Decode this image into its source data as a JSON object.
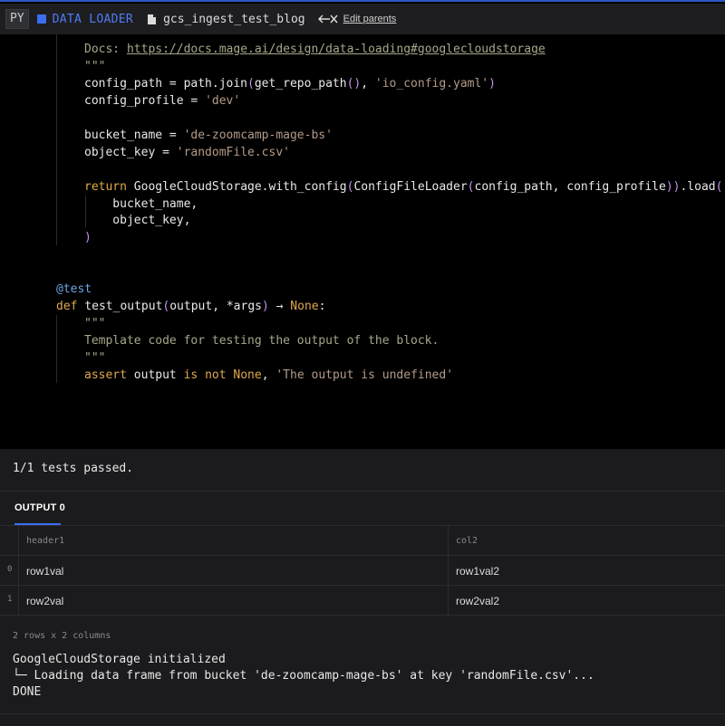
{
  "header": {
    "lang_badge": "PY",
    "block_type": "DATA LOADER",
    "block_name": "gcs_ingest_test_blog",
    "edit_parents": "Edit parents",
    "colors": {
      "accent": "#3a6ff0",
      "bar": "#1e1e21"
    }
  },
  "code": {
    "lines": [
      {
        "t": [
          [
            "c-doc",
            "Docs: "
          ],
          [
            "c-link",
            "https://docs.mage.ai/design/data-loading#googlecloudstorage"
          ]
        ]
      },
      {
        "t": [
          [
            "c-doc",
            "\"\"\""
          ]
        ]
      },
      {
        "t": [
          [
            "c-plain",
            "config_path = path.join"
          ],
          [
            "c-paren",
            "("
          ],
          [
            "c-plain",
            "get_repo_path"
          ],
          [
            "c-paren",
            "()"
          ],
          [
            "c-plain",
            ", "
          ],
          [
            "c-str",
            "'io_config.yaml'"
          ],
          [
            "c-paren",
            ")"
          ]
        ]
      },
      {
        "t": [
          [
            "c-plain",
            "config_profile = "
          ],
          [
            "c-str",
            "'dev'"
          ]
        ]
      },
      {
        "t": []
      },
      {
        "t": [
          [
            "c-plain",
            "bucket_name = "
          ],
          [
            "c-str",
            "'de-zoomcamp-mage-bs'"
          ]
        ]
      },
      {
        "t": [
          [
            "c-plain",
            "object_key = "
          ],
          [
            "c-str",
            "'randomFile.csv'"
          ]
        ]
      },
      {
        "t": []
      },
      {
        "t": [
          [
            "c-kw",
            "return "
          ],
          [
            "c-plain",
            "GoogleCloudStorage.with_config"
          ],
          [
            "c-paren",
            "("
          ],
          [
            "c-plain",
            "ConfigFileLoader"
          ],
          [
            "c-paren",
            "("
          ],
          [
            "c-plain",
            "config_path, config_profile"
          ],
          [
            "c-paren",
            "))"
          ],
          [
            "c-plain",
            ".load"
          ],
          [
            "c-paren",
            "("
          ]
        ]
      },
      {
        "t": [
          [
            "c-plain",
            "    bucket_name,"
          ]
        ]
      },
      {
        "t": [
          [
            "c-plain",
            "    object_key,"
          ]
        ]
      },
      {
        "t": [
          [
            "c-paren",
            ")"
          ]
        ]
      },
      {
        "t": []
      },
      {
        "t": []
      },
      {
        "t": [
          [
            "c-dec",
            "@test"
          ]
        ]
      },
      {
        "t": [
          [
            "c-kw",
            "def "
          ],
          [
            "c-plain",
            "test_output"
          ],
          [
            "c-paren",
            "("
          ],
          [
            "c-plain",
            "output, *args"
          ],
          [
            "c-paren",
            ")"
          ],
          [
            "c-plain",
            " → "
          ],
          [
            "c-none",
            "None"
          ],
          [
            "c-plain",
            ":"
          ]
        ]
      },
      {
        "t": [
          [
            "c-doc",
            "\"\"\""
          ]
        ]
      },
      {
        "t": [
          [
            "c-doc",
            "Template code for testing the output of the block."
          ]
        ]
      },
      {
        "t": [
          [
            "c-doc",
            "\"\"\""
          ]
        ]
      },
      {
        "t": [
          [
            "c-kw",
            "assert "
          ],
          [
            "c-plain",
            "output "
          ],
          [
            "c-kw",
            "is not "
          ],
          [
            "c-none",
            "None"
          ],
          [
            "c-plain",
            ", "
          ],
          [
            "c-str",
            "'The output is undefined'"
          ]
        ]
      }
    ]
  },
  "output": {
    "tests_passed": "1/1 tests passed.",
    "tab_label": "OUTPUT 0",
    "table": {
      "headers": [
        "header1",
        "col2"
      ],
      "rows": [
        {
          "index": "0",
          "cells": [
            "row1val",
            "row1val2"
          ]
        },
        {
          "index": "1",
          "cells": [
            "row2val",
            "row2val2"
          ]
        }
      ]
    },
    "shape": "2 rows x 2 columns",
    "log": [
      "GoogleCloudStorage initialized",
      "└─ Loading data frame from bucket 'de-zoomcamp-mage-bs' at key 'randomFile.csv'...",
      "DONE"
    ]
  }
}
